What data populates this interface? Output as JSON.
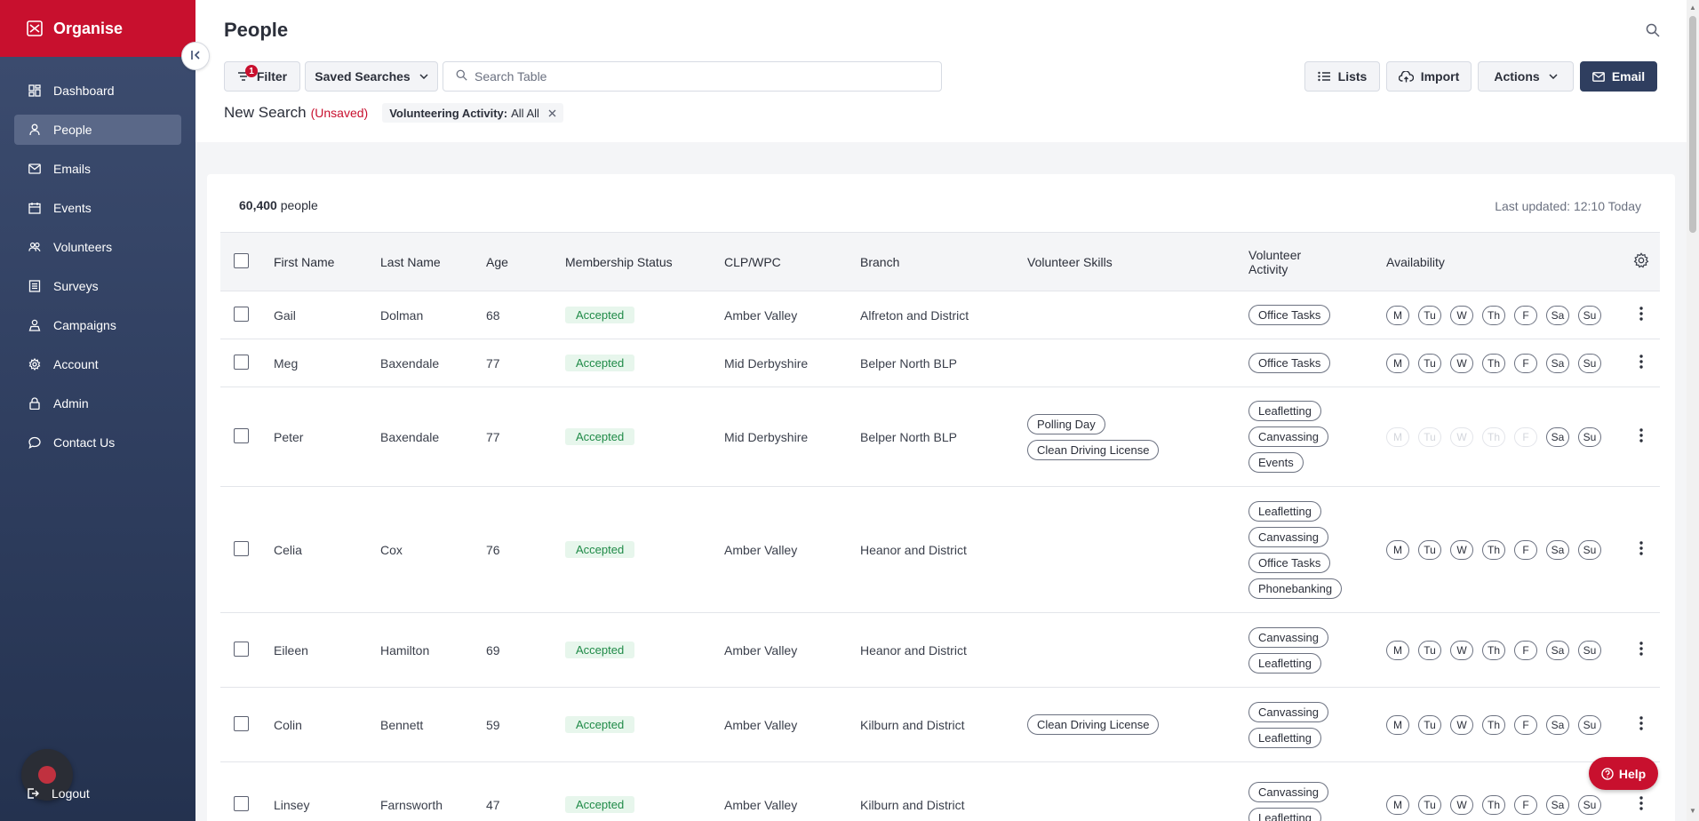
{
  "app": {
    "brand": "Organise"
  },
  "sidebar": {
    "items": [
      {
        "label": "Dashboard",
        "icon": "dashboard-icon",
        "active": false
      },
      {
        "label": "People",
        "icon": "person-icon",
        "active": true
      },
      {
        "label": "Emails",
        "icon": "mail-icon",
        "active": false
      },
      {
        "label": "Events",
        "icon": "calendar-icon",
        "active": false
      },
      {
        "label": "Volunteers",
        "icon": "users-icon",
        "active": false
      },
      {
        "label": "Surveys",
        "icon": "list-icon",
        "active": false
      },
      {
        "label": "Campaigns",
        "icon": "megaphone-icon",
        "active": false
      },
      {
        "label": "Account",
        "icon": "gear-icon",
        "active": false
      },
      {
        "label": "Admin",
        "icon": "lock-icon",
        "active": false
      },
      {
        "label": "Contact Us",
        "icon": "chat-icon",
        "active": false
      }
    ],
    "logout": "Logout"
  },
  "header": {
    "title": "People",
    "filter_label": "Filter",
    "filter_count": "1",
    "saved_searches_label": "Saved Searches",
    "search_placeholder": "Search Table",
    "lists_label": "Lists",
    "import_label": "Import",
    "actions_label": "Actions",
    "email_label": "Email",
    "search_name": "New Search",
    "unsaved": "(Unsaved)",
    "chip_key": "Volunteering Activity:",
    "chip_value": "All All"
  },
  "summary": {
    "count": "60,400",
    "count_suffix": "people",
    "last_updated": "Last updated: 12:10 Today"
  },
  "table": {
    "headers": {
      "first_name": "First Name",
      "last_name": "Last Name",
      "age": "Age",
      "membership": "Membership Status",
      "clp": "CLP/WPC",
      "branch": "Branch",
      "skills": "Volunteer Skills",
      "activity_line1": "Volunteer",
      "activity_line2": "Activity",
      "availability": "Availability"
    },
    "days": [
      "M",
      "Tu",
      "W",
      "Th",
      "F",
      "Sa",
      "Su"
    ],
    "rows": [
      {
        "first": "Gail",
        "last": "Dolman",
        "age": "68",
        "status": "Accepted",
        "clp": "Amber Valley",
        "branch": "Alfreton and District",
        "skills": [],
        "activities": [
          "Office Tasks"
        ],
        "available": [
          true,
          true,
          true,
          true,
          true,
          true,
          true
        ]
      },
      {
        "first": "Meg",
        "last": "Baxendale",
        "age": "77",
        "status": "Accepted",
        "clp": "Mid Derbyshire",
        "branch": "Belper North BLP",
        "skills": [],
        "activities": [
          "Office Tasks"
        ],
        "available": [
          true,
          true,
          true,
          true,
          true,
          true,
          true
        ]
      },
      {
        "first": "Peter",
        "last": "Baxendale",
        "age": "77",
        "status": "Accepted",
        "clp": "Mid Derbyshire",
        "branch": "Belper North BLP",
        "skills": [
          "Polling Day",
          "Clean Driving License"
        ],
        "activities": [
          "Leafletting",
          "Canvassing",
          "Events"
        ],
        "available": [
          false,
          false,
          false,
          false,
          false,
          true,
          true
        ]
      },
      {
        "first": "Celia",
        "last": "Cox",
        "age": "76",
        "status": "Accepted",
        "clp": "Amber Valley",
        "branch": "Heanor and District",
        "skills": [],
        "activities": [
          "Leafletting",
          "Canvassing",
          "Office Tasks",
          "Phonebanking"
        ],
        "available": [
          true,
          true,
          true,
          true,
          true,
          true,
          true
        ]
      },
      {
        "first": "Eileen",
        "last": "Hamilton",
        "age": "69",
        "status": "Accepted",
        "clp": "Amber Valley",
        "branch": "Heanor and District",
        "skills": [],
        "activities": [
          "Canvassing",
          "Leafletting"
        ],
        "available": [
          true,
          true,
          true,
          true,
          true,
          true,
          true
        ]
      },
      {
        "first": "Colin",
        "last": "Bennett",
        "age": "59",
        "status": "Accepted",
        "clp": "Amber Valley",
        "branch": "Kilburn and District",
        "skills": [
          "Clean Driving License"
        ],
        "activities": [
          "Canvassing",
          "Leafletting"
        ],
        "available": [
          true,
          true,
          true,
          true,
          true,
          true,
          true
        ]
      },
      {
        "first": "Linsey",
        "last": "Farnsworth",
        "age": "47",
        "status": "Accepted",
        "clp": "Amber Valley",
        "branch": "Kilburn and District",
        "skills": [],
        "activities": [
          "Canvassing",
          "Leafletting"
        ],
        "available": [
          true,
          true,
          true,
          true,
          true,
          true,
          true
        ]
      }
    ]
  },
  "help": {
    "label": "Help"
  },
  "colors": {
    "brand": "#c8102e",
    "sidebar": "#2f3e5f",
    "accepted": "#1f8a47"
  }
}
